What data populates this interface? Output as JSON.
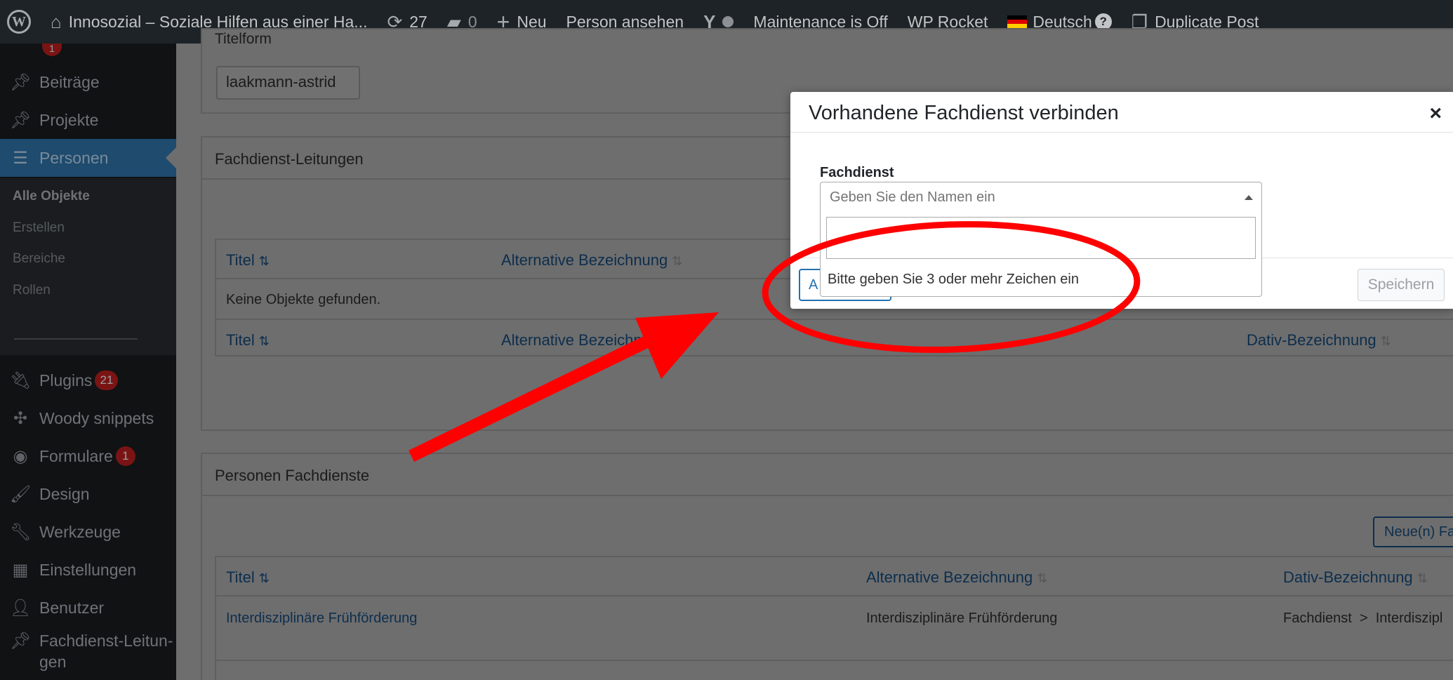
{
  "adminbar": {
    "site_title": "Innosozial – Soziale Hilfen aus einer Ha...",
    "updates_count": "27",
    "comments_count": "0",
    "new_label": "Neu",
    "view_person": "Person ansehen",
    "maintenance": "Maintenance is Off",
    "wp_rocket": "WP Rocket",
    "language": "Deutsch",
    "help": "?",
    "duplicate_post": "Duplicate Post"
  },
  "sidebar": {
    "top_badge": "1",
    "items": [
      {
        "label": "Beiträge"
      },
      {
        "label": "Projekte"
      },
      {
        "label": "Personen"
      },
      {
        "label": "Plugins",
        "badge": "21"
      },
      {
        "label": "Woody snippets"
      },
      {
        "label": "Formulare",
        "badge": "1"
      },
      {
        "label": "Design"
      },
      {
        "label": "Werkzeuge"
      },
      {
        "label": "Einstellungen"
      },
      {
        "label": "Benutzer"
      },
      {
        "label": "Fachdienst-Leitun-"
      },
      {
        "label": "gen"
      }
    ],
    "submenu": [
      "Alle Objekte",
      "Erstellen",
      "Bereiche",
      "Rollen"
    ]
  },
  "main": {
    "slug_section_title": "Titelform",
    "slug_value": "laakmann-astrid",
    "section1": {
      "title": "Fachdienst-Leitungen",
      "col_title": "Titel",
      "col_alt": "Alternative Bezeichnung",
      "col_dativ": "Dativ-Bezeichnung",
      "empty": "Keine Objekte gefunden."
    },
    "section2": {
      "title": "Personen Fachdienste",
      "new_button": "Neue(n) Fa",
      "col_title": "Titel",
      "col_alt": "Alternative Bezeichnung",
      "col_dativ": "Dativ-Bezeichnung",
      "row_title": "Interdisziplinäre Frühförderung",
      "row_alt": "Interdisziplinäre Frühförderung",
      "row_dativ": "Fachdienst  >  Interdiszipl"
    }
  },
  "modal": {
    "title": "Vorhandene Fachdienst verbinden",
    "close": "×",
    "field_label": "Fachdienst",
    "placeholder": "Geben Sie den Namen ein",
    "hint": "Bitte geben Sie 3 oder mehr Zeichen ein",
    "left_button": "A",
    "save_button": "Speichern"
  },
  "colors": {
    "annotation_red": "#ff0000",
    "adminbar_bg": "#1d2327",
    "wp_blue": "#2271b1"
  }
}
